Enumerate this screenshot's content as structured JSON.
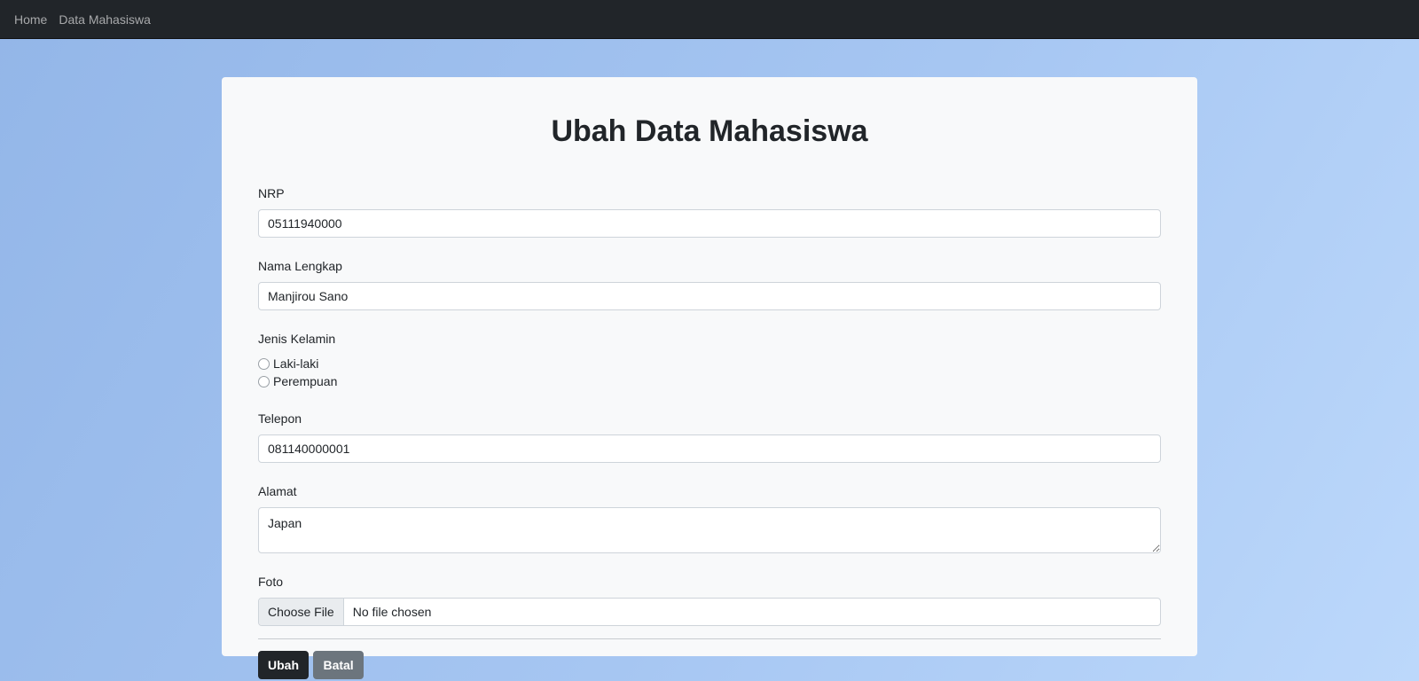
{
  "nav": {
    "items": [
      {
        "label": "Home"
      },
      {
        "label": "Data Mahasiswa"
      }
    ]
  },
  "form": {
    "title": "Ubah Data Mahasiswa",
    "nrp": {
      "label": "NRP",
      "value": "05111940000"
    },
    "nama": {
      "label": "Nama Lengkap",
      "value": "Manjirou Sano"
    },
    "jenis_kelamin": {
      "label": "Jenis Kelamin",
      "options": [
        {
          "label": "Laki-laki",
          "checked": false
        },
        {
          "label": "Perempuan",
          "checked": false
        }
      ]
    },
    "telepon": {
      "label": "Telepon",
      "value": "081140000001"
    },
    "alamat": {
      "label": "Alamat",
      "value": "Japan"
    },
    "foto": {
      "label": "Foto",
      "button_label": "Choose File",
      "status": "No file chosen"
    },
    "buttons": {
      "submit": "Ubah",
      "cancel": "Batal"
    }
  },
  "colors": {
    "navbar": "#212529",
    "card": "#f8f9fa",
    "primary_button": "#212529",
    "secondary_button": "#6c757d"
  }
}
